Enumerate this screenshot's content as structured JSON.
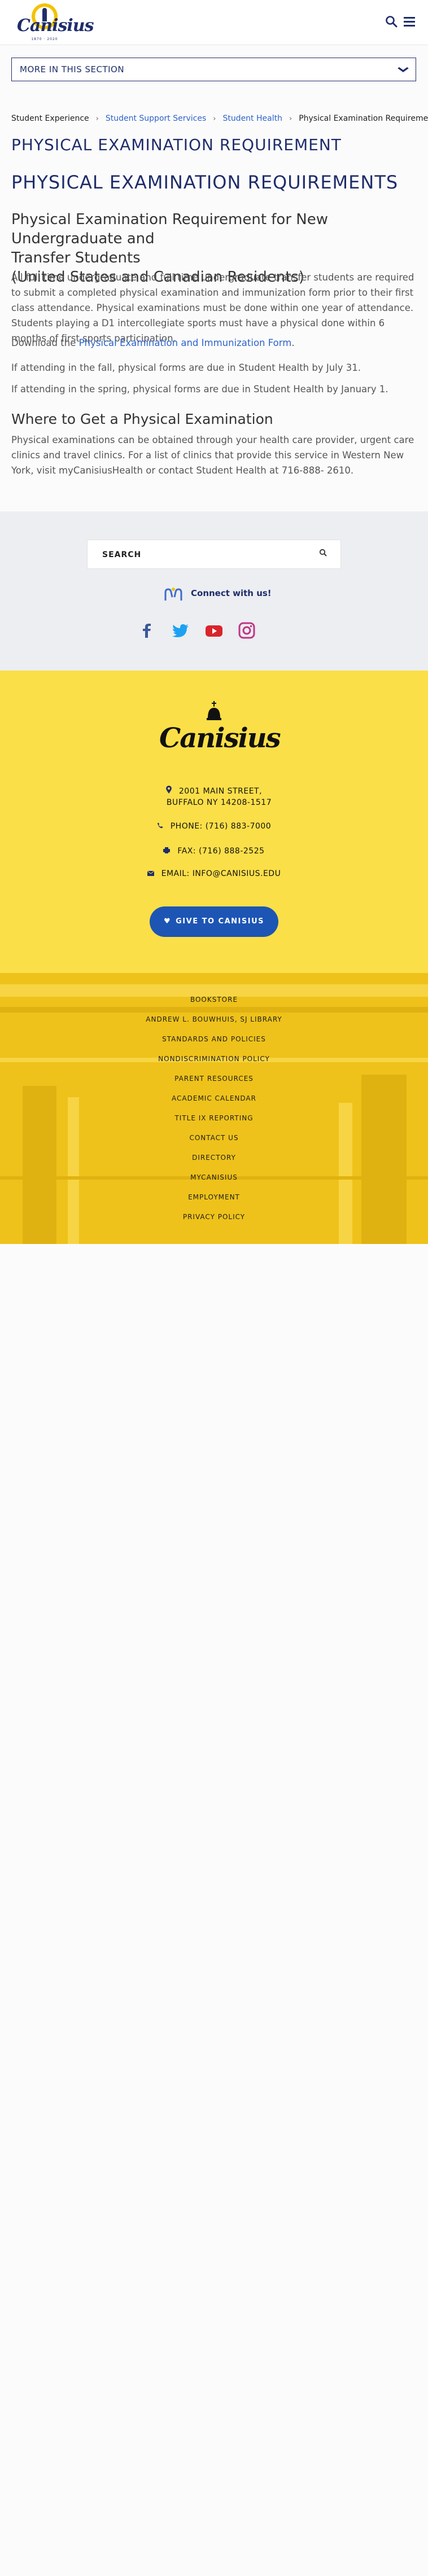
{
  "header": {
    "logo_wordmark": "Canisius",
    "logo_years": "1870 · 2020",
    "search_icon": "search-icon",
    "menu_icon": "hamburger-menu-icon"
  },
  "section_nav": {
    "label": "MORE IN THIS SECTION",
    "icon": "chevron-down-icon"
  },
  "breadcrumb": [
    {
      "label": "Student Experience",
      "link": false
    },
    {
      "label": "Student Support Services",
      "link": true
    },
    {
      "label": "Student Health",
      "link": true
    },
    {
      "label": "Physical Examination Requirement",
      "link": false
    }
  ],
  "content": {
    "page_title": "PHYSICAL EXAMINATION REQUIREMENT",
    "heading": "PHYSICAL EXAMINATION REQUIREMENTS",
    "subheading_line1": "Physical Examination Requirement for New Undergraduate and",
    "subheading_line2": "Transfer Students",
    "subheading_line3": "(United States and Canadian Residents)",
    "para1": "All full time undergraduate and full time undergraduate transfer students are required to submit a completed physical examination and immunization form prior to their first class attendance. Physical examinations must be done within one year of attendance. Students playing a D1 intercollegiate sports must have a physical done within 6 months of first sports participation.",
    "para2_prefix": "Download the ",
    "para2_link": "Physical Examination and Immunization Form",
    "para2_suffix": ".",
    "para3": "If attending in the fall, physical forms are due in Student Health by July 31.",
    "para4": "If attending in the spring, physical forms are due in Student Health by January 1.",
    "where_heading": "Where to Get a Physical Examination",
    "para5": "Physical examinations can be obtained through your health care provider, urgent care clinics and travel clinics. For a list of clinics that provide this service in Western New York, visit myCanisiusHealth or contact Student Health at 716-888- 2610."
  },
  "search_band": {
    "placeholder": "SEARCH",
    "connect_text": "Connect with us!",
    "social": [
      "facebook-icon",
      "twitter-icon",
      "youtube-icon",
      "instagram-icon"
    ],
    "colors": {
      "facebook": "#3b5998",
      "twitter": "#1da1f2",
      "youtube": "#d9252a",
      "instagram": "#c13584"
    }
  },
  "footer_contact": {
    "logo_wordmark": "Canisius",
    "address_line1": "2001 MAIN STREET,",
    "address_line2": "BUFFALO NY 14208-1517",
    "phone": "PHONE: (716) 883-7000",
    "fax": "FAX: (716) 888-2525",
    "email": "EMAIL: INFO@CANISIUS.EDU",
    "give_button": "GIVE TO CANISIUS"
  },
  "footer_links": [
    "BOOKSTORE",
    "ANDREW L. BOUWHUIS, SJ LIBRARY",
    "STANDARDS AND POLICIES",
    "NONDISCRIMINATION POLICY",
    "PARENT RESOURCES",
    "ACADEMIC CALENDAR",
    "TITLE IX REPORTING",
    "CONTACT US",
    "DIRECTORY",
    "MYCANISIUS",
    "EMPLOYMENT",
    "PRIVACY POLICY"
  ],
  "colors": {
    "navy": "#1f2d6b",
    "link_blue": "#2e63c9",
    "brand_yellow": "#fbdf48",
    "give_blue": "#1d55b4"
  }
}
